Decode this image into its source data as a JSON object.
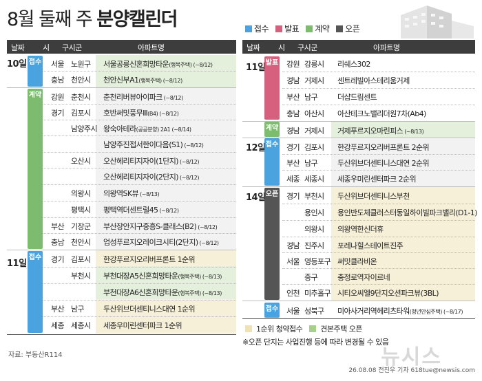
{
  "title_light": "8월 둘째 주 ",
  "title_bold": "분양캘린더",
  "legend": [
    {
      "label": "접수",
      "color": "#4aa3df"
    },
    {
      "label": "발표",
      "color": "#d6607d"
    },
    {
      "label": "계약",
      "color": "#7dbb6e"
    },
    {
      "label": "오픈",
      "color": "#555555"
    }
  ],
  "headers": {
    "date": "날짜",
    "city": "시",
    "district": "구시군",
    "apt": "아파트명"
  },
  "left": {
    "dates": [
      "10일",
      "11일"
    ],
    "tags": [
      "접수",
      "계약",
      "접수"
    ],
    "rows": [
      {
        "city": "서울",
        "district": "노원구",
        "apt": "서울공릉신혼희망타운",
        "note": "(행복주택)",
        "period": "(~8/12)"
      },
      {
        "city": "충남",
        "district": "천안시",
        "apt": "천안신부A1",
        "note": "(행복주택)",
        "period": "(~8/12)"
      },
      {
        "city": "강원",
        "district": "춘천시",
        "apt": "춘천리버뷰아이파크",
        "note": "",
        "period": "(~8/12)"
      },
      {
        "city": "경기",
        "district": "김포시",
        "apt": "호반써밋풍무Ⅲ",
        "note": "(B4)",
        "period": "(~8/12)"
      },
      {
        "city": "",
        "district": "남양주시",
        "apt": "왕숙아테라",
        "note": "(공공분양)",
        "period": "2A1 (~8/14)"
      },
      {
        "city": "",
        "district": "",
        "apt": "남양주진접서한이다음(S1)",
        "note": "",
        "period": "(~8/12)"
      },
      {
        "city": "",
        "district": "오산시",
        "apt": "오산헤리티지자이(1단지)",
        "note": "",
        "period": "(~8/12)"
      },
      {
        "city": "",
        "district": "",
        "apt": "오산헤리티지자이(2단지)",
        "note": "",
        "period": "(~8/12)"
      },
      {
        "city": "",
        "district": "의왕시",
        "apt": "의왕역SK뷰",
        "note": "",
        "period": "(~8/13)"
      },
      {
        "city": "",
        "district": "평택시",
        "apt": "평택역더센트럴45",
        "note": "",
        "period": "(~8/12)"
      },
      {
        "city": "부산",
        "district": "기장군",
        "apt": "부산장안지구중흥S-클래스(B2)",
        "note": "",
        "period": "(~8/12)"
      },
      {
        "city": "충남",
        "district": "천안시",
        "apt": "업성푸르지오레이크시티(2단지)",
        "note": "",
        "period": "(~8/12)"
      },
      {
        "city": "경기",
        "district": "김포시",
        "apt": "한강푸르지오리버프론트 1순위",
        "note": "",
        "period": ""
      },
      {
        "city": "",
        "district": "부천시",
        "apt": "부천대장A5신혼희망타운",
        "note": "(행복주택)",
        "period": "(~8/13)"
      },
      {
        "city": "",
        "district": "",
        "apt": "부천대장A6신혼희망타운",
        "note": "(행복주택)",
        "period": "(~8/13)"
      },
      {
        "city": "부산",
        "district": "남구",
        "apt": "두산위브더센티니스대연 1순위",
        "note": "",
        "period": ""
      },
      {
        "city": "세종",
        "district": "세종시",
        "apt": "세종우미린센터파크 1순위",
        "note": "",
        "period": ""
      }
    ]
  },
  "right": {
    "dates": [
      "11일",
      "12일",
      "14일"
    ],
    "tags": [
      "발표",
      "계약",
      "접수",
      "오픈",
      "접수"
    ],
    "rows": [
      {
        "city": "강원",
        "district": "강릉시",
        "apt": "리쉐스302",
        "note": "",
        "period": ""
      },
      {
        "city": "경남",
        "district": "거제시",
        "apt": "센트레빌아스테리움거제",
        "note": "",
        "period": ""
      },
      {
        "city": "부산",
        "district": "남구",
        "apt": "더샵드림센트",
        "note": "",
        "period": ""
      },
      {
        "city": "충남",
        "district": "아산시",
        "apt": "아산테크노밸리더원7차(Ab4)",
        "note": "",
        "period": ""
      },
      {
        "city": "경남",
        "district": "거제시",
        "apt": "거제푸르지오마린피스",
        "note": "",
        "period": "(~8/13)"
      },
      {
        "city": "경기",
        "district": "김포시",
        "apt": "한강푸르지오리버프론트 2순위",
        "note": "",
        "period": ""
      },
      {
        "city": "부산",
        "district": "남구",
        "apt": "두산위브더센티니스대연 2순위",
        "note": "",
        "period": ""
      },
      {
        "city": "세종",
        "district": "세종시",
        "apt": "세종우미린센터파크 2순위",
        "note": "",
        "period": ""
      },
      {
        "city": "경기",
        "district": "부천시",
        "apt": "두산위브더센티니스부천",
        "note": "",
        "period": ""
      },
      {
        "city": "",
        "district": "용인시",
        "apt": "용인반도체클러스터동일하이빌파크밸리(D1-1)",
        "note": "",
        "period": ""
      },
      {
        "city": "",
        "district": "의왕시",
        "apt": "의왕역한신더휴",
        "note": "",
        "period": ""
      },
      {
        "city": "경남",
        "district": "진주시",
        "apt": "포레나힐스테이트진주",
        "note": "",
        "period": ""
      },
      {
        "city": "서울",
        "district": "영등포구",
        "apt": "써밋클라비온",
        "note": "",
        "period": ""
      },
      {
        "city": "",
        "district": "중구",
        "apt": "충정로역자이르네",
        "note": "",
        "period": ""
      },
      {
        "city": "인천",
        "district": "미추홀구",
        "apt": "시티오씨엘9단지오션파크뷰(3BL)",
        "note": "",
        "period": ""
      },
      {
        "city": "서울",
        "district": "성북구",
        "apt": "미아사거리역헤리츠타워",
        "note": "(청년안심주택)",
        "period": "(~8/17)"
      }
    ]
  },
  "legend_bottom": [
    {
      "label": "1순위 청약접수",
      "color": "#efe2b8"
    },
    {
      "label": "견본주택 오픈",
      "color": "#a8d08d"
    }
  ],
  "note": "※오픈 단지는 사업진행 등에 따라 변경될 수 있음",
  "source": "자료: 부동산R114",
  "credit": "26.08.08 전진우 기자 618tue@newsis.com",
  "watermark": "뉴시스"
}
